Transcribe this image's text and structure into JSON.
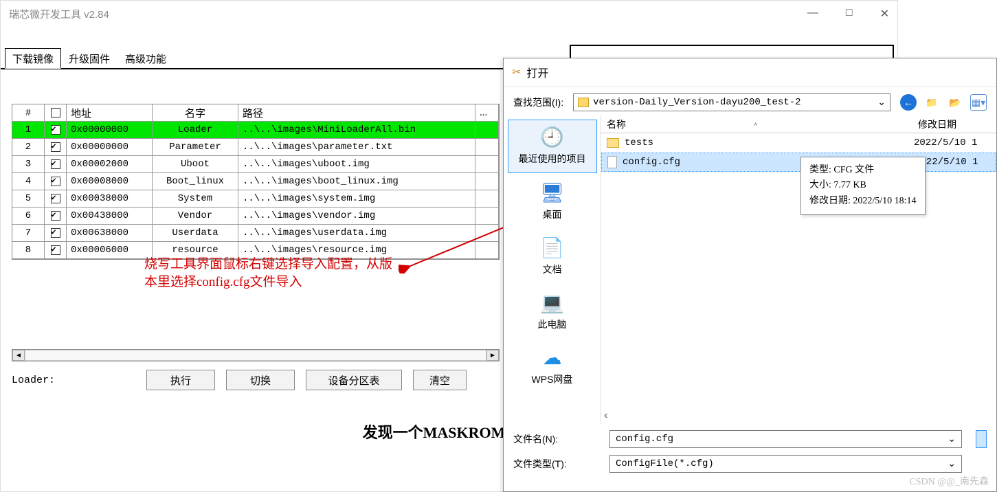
{
  "window": {
    "title": "瑞芯微开发工具 v2.84",
    "min": "—",
    "max": "□",
    "close": "✕"
  },
  "tabs": [
    "下载镜像",
    "升级固件",
    "高级功能"
  ],
  "table": {
    "headers": {
      "num": "#",
      "addr": "地址",
      "name": "名字",
      "path": "路径",
      "last": "..."
    },
    "rows": [
      {
        "n": "1",
        "addr": "0x00000000",
        "name": "Loader",
        "path": "..\\..\\images\\MiniLoaderAll.bin",
        "hl": true
      },
      {
        "n": "2",
        "addr": "0x00000000",
        "name": "Parameter",
        "path": "..\\..\\images\\parameter.txt",
        "hl": false
      },
      {
        "n": "3",
        "addr": "0x00002000",
        "name": "Uboot",
        "path": "..\\..\\images\\uboot.img",
        "hl": false
      },
      {
        "n": "4",
        "addr": "0x00008000",
        "name": "Boot_linux",
        "path": "..\\..\\images\\boot_linux.img",
        "hl": false
      },
      {
        "n": "5",
        "addr": "0x00038000",
        "name": "System",
        "path": "..\\..\\images\\system.img",
        "hl": false
      },
      {
        "n": "6",
        "addr": "0x00438000",
        "name": "Vendor",
        "path": "..\\..\\images\\vendor.img",
        "hl": false
      },
      {
        "n": "7",
        "addr": "0x00638000",
        "name": "Userdata",
        "path": "..\\..\\images\\userdata.img",
        "hl": false
      },
      {
        "n": "8",
        "addr": "0x00006000",
        "name": "resource",
        "path": "..\\..\\images\\resource.img",
        "hl": false
      }
    ]
  },
  "annotation": "烧写工具界面鼠标右键选择导入配置，从版本里选择config.cfg文件导入",
  "loader_label": "Loader:",
  "buttons": {
    "exec": "执行",
    "swap": "切换",
    "part": "设备分区表",
    "clear": "清空"
  },
  "status": "发现一个MASKROM设备",
  "file_dialog": {
    "title": "打开",
    "lookin_label": "查找范围(I):",
    "lookin_value": "version-Daily_Version-dayu200_test-2",
    "columns": {
      "name": "名称",
      "date": "修改日期"
    },
    "places": {
      "recent": "最近使用的项目",
      "desktop": "桌面",
      "documents": "文档",
      "computer": "此电脑",
      "wps": "WPS网盘"
    },
    "rows": [
      {
        "name": "tests",
        "date": "2022/5/10 1",
        "type": "folder"
      },
      {
        "name": "config.cfg",
        "date": "2022/5/10 1",
        "type": "file",
        "selected": true
      }
    ],
    "tooltip": {
      "l1": "类型: CFG 文件",
      "l2": "大小: 7.77 KB",
      "l3": "修改日期: 2022/5/10 18:14"
    },
    "filename_label": "文件名(N):",
    "filename_value": "config.cfg",
    "filetype_label": "文件类型(T):",
    "filetype_value": "ConfigFile(*.cfg)"
  },
  "watermark": "CSDN @@_南先森"
}
